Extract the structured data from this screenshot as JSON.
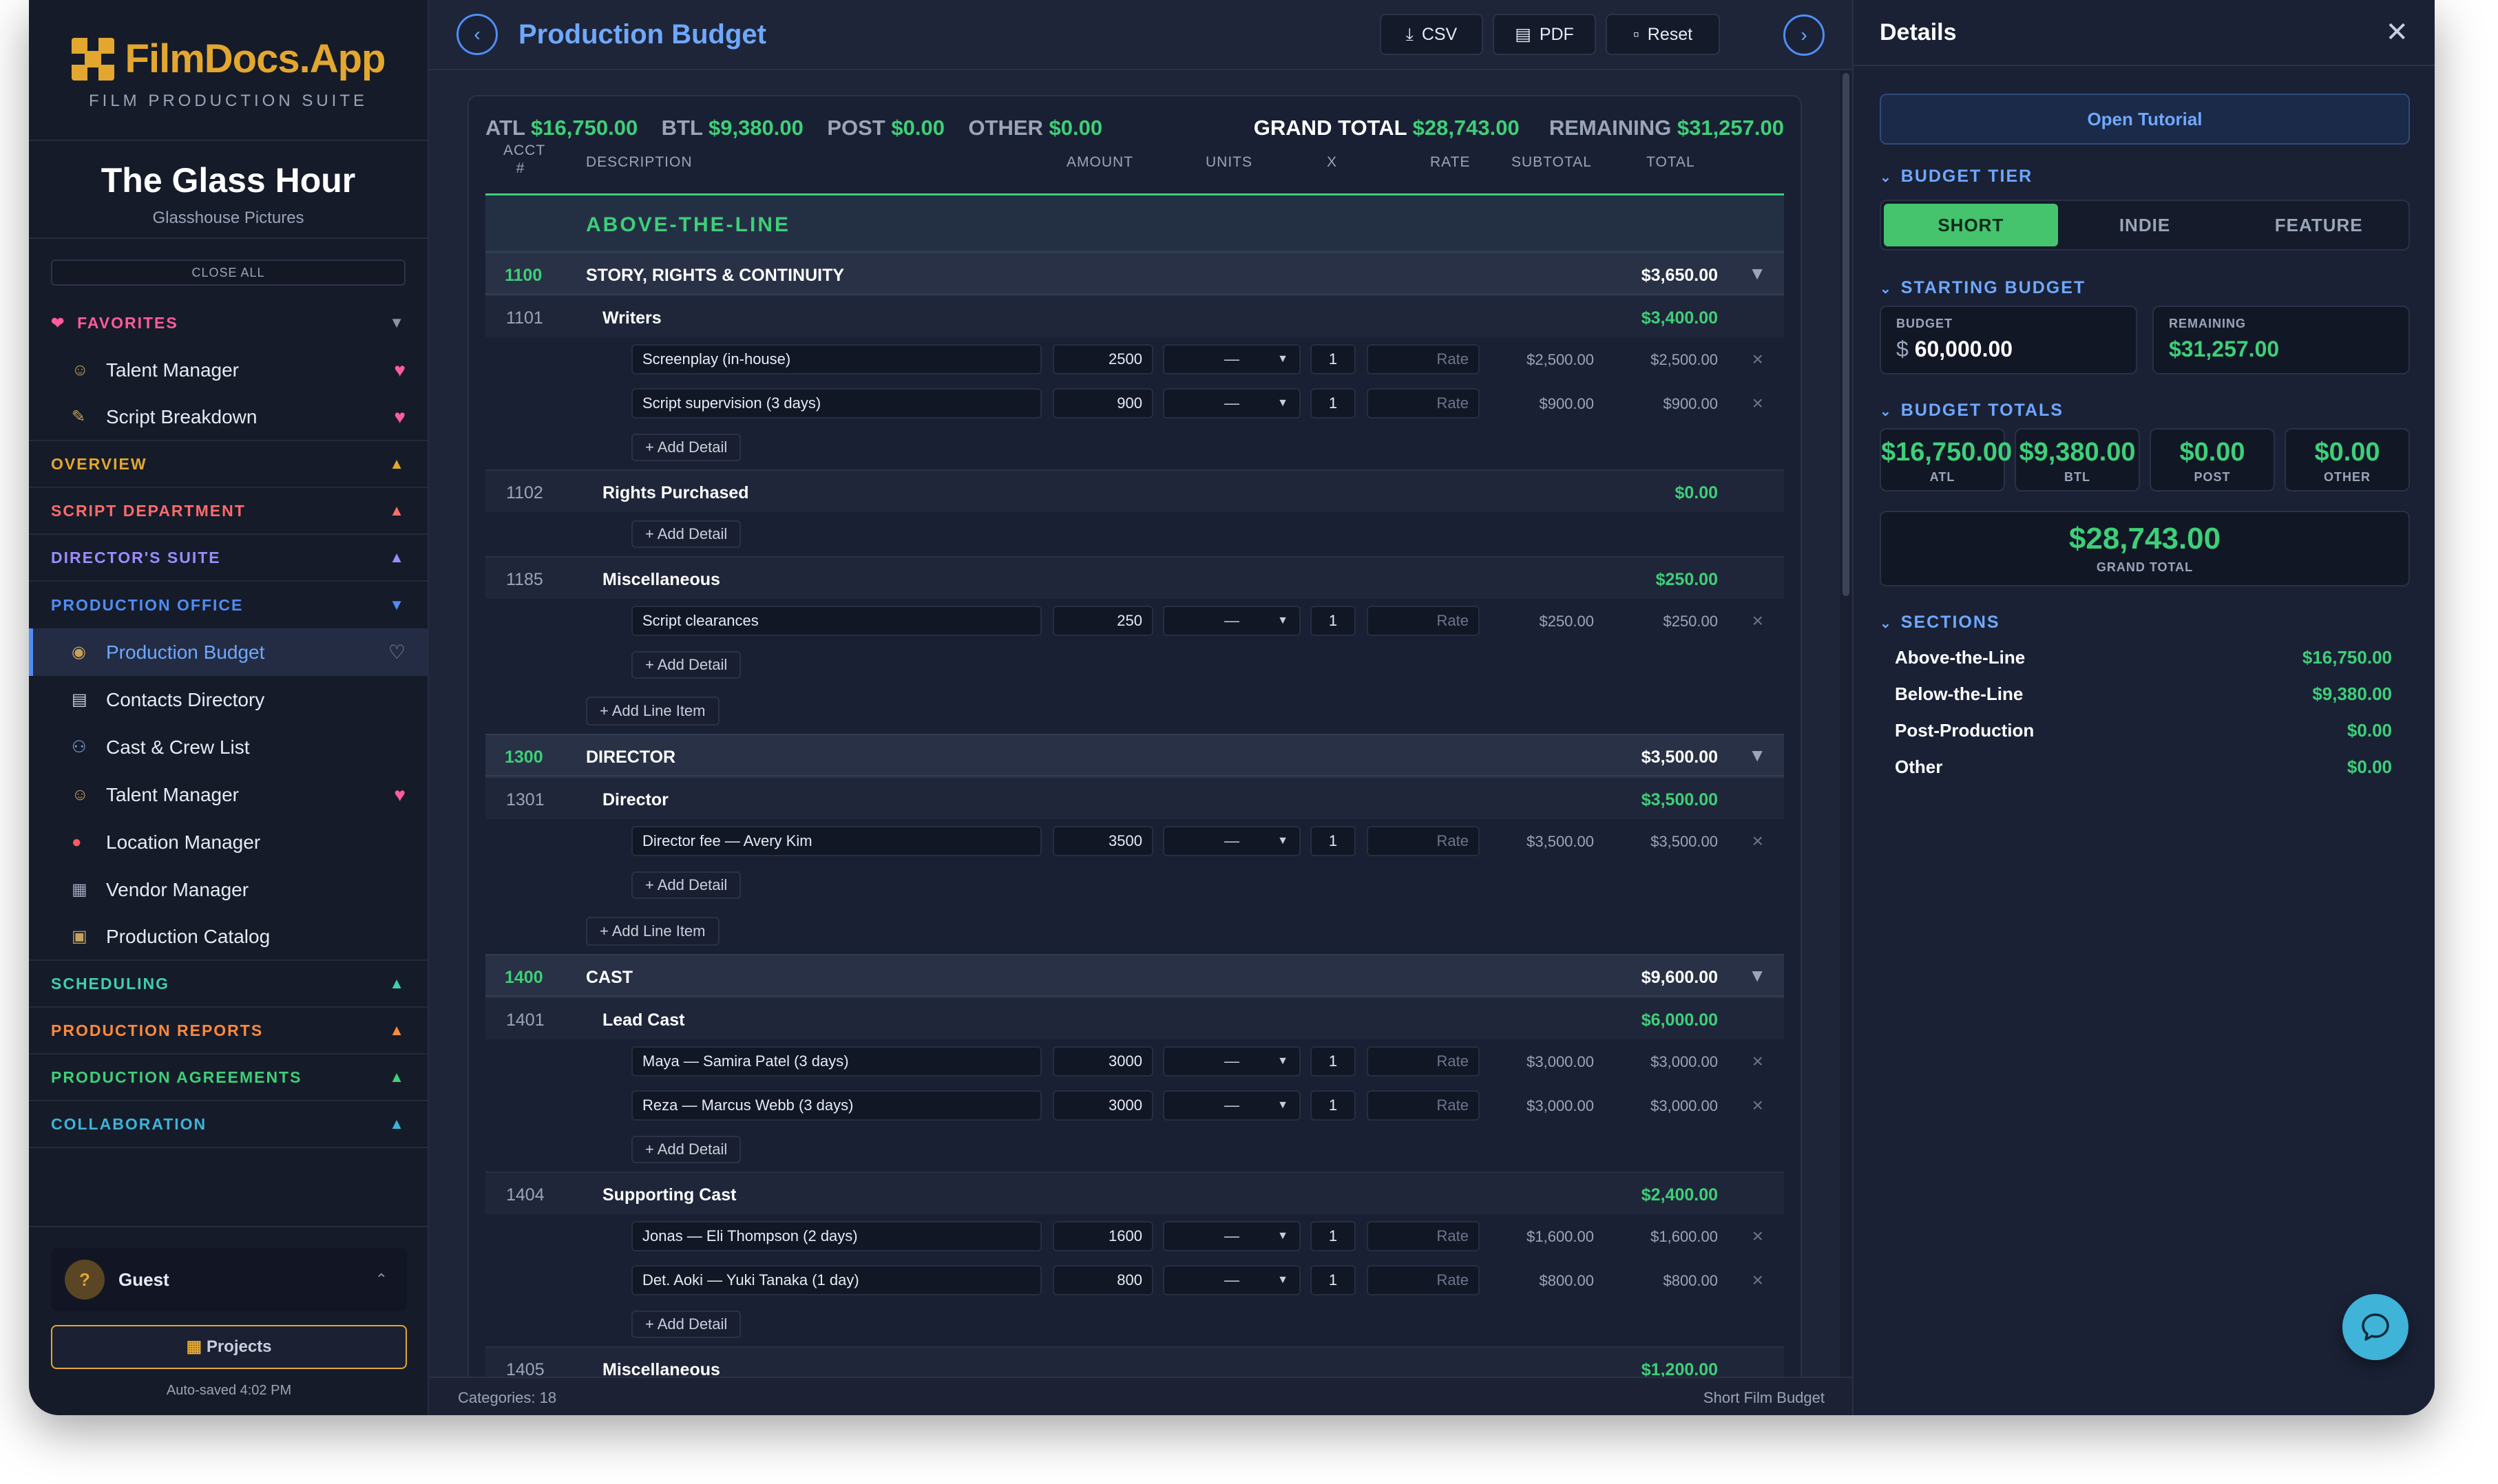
{
  "app": {
    "name": "FilmDocs.App",
    "subtitle": "FILM PRODUCTION SUITE"
  },
  "project": {
    "title": "The Glass Hour",
    "company": "Glasshouse Pictures"
  },
  "sidebar": {
    "close_all": "CLOSE ALL",
    "favorites": {
      "label": "FAVORITES",
      "color": "#ff5c9a",
      "items": [
        {
          "label": "Talent Manager",
          "icon": "theater-masks-icon"
        },
        {
          "label": "Script Breakdown",
          "icon": "memo-icon"
        }
      ]
    },
    "sections": [
      {
        "label": "OVERVIEW",
        "color": "#e3a730"
      },
      {
        "label": "SCRIPT DEPARTMENT",
        "color": "#ff6b6b"
      },
      {
        "label": "DIRECTOR'S SUITE",
        "color": "#9b8cff"
      },
      {
        "label": "PRODUCTION OFFICE",
        "color": "#4f8df5"
      }
    ],
    "office_items": [
      {
        "label": "Production Budget",
        "icon": "money-bag-icon"
      },
      {
        "label": "Contacts Directory",
        "icon": "address-book-icon"
      },
      {
        "label": "Cast & Crew List",
        "icon": "people-icon"
      },
      {
        "label": "Talent Manager",
        "icon": "theater-masks-icon"
      },
      {
        "label": "Location Manager",
        "icon": "pin-icon"
      },
      {
        "label": "Vendor Manager",
        "icon": "building-icon"
      },
      {
        "label": "Production Catalog",
        "icon": "package-icon"
      }
    ],
    "bottom_sections": [
      {
        "label": "SCHEDULING",
        "color": "#3ecfb0"
      },
      {
        "label": "PRODUCTION REPORTS",
        "color": "#ff8a3d"
      },
      {
        "label": "PRODUCTION AGREEMENTS",
        "color": "#3ecf78"
      },
      {
        "label": "COLLABORATION",
        "color": "#3fb3d8"
      }
    ],
    "user": {
      "avatar": "?",
      "name": "Guest"
    },
    "projects_button": "Projects",
    "autosave": "Auto-saved 4:02 PM"
  },
  "toolbar": {
    "title": "Production Budget",
    "csv": "CSV",
    "pdf": "PDF",
    "reset": "Reset"
  },
  "summary": {
    "atl_label": "ATL",
    "atl": "$16,750.00",
    "btl_label": "BTL",
    "btl": "$9,380.00",
    "post_label": "POST",
    "post": "$0.00",
    "other_label": "OTHER",
    "other": "$0.00",
    "grand_label": "GRAND TOTAL",
    "grand": "$28,743.00",
    "remaining_label": "REMAINING",
    "remaining": "$31,257.00"
  },
  "columns": {
    "acct": "ACCT #",
    "description": "DESCRIPTION",
    "amount": "AMOUNT",
    "units": "UNITS",
    "x": "X",
    "rate": "RATE",
    "subtotal": "SUBTOTAL",
    "total": "TOTAL"
  },
  "section_title": "ABOVE-THE-LINE",
  "labels": {
    "add_detail": "+ Add Detail",
    "add_line": "+ Add Line Item",
    "rate_placeholder": "Rate",
    "units_value": "—"
  },
  "categories": [
    {
      "acct": "1100",
      "name": "STORY, RIGHTS & CONTINUITY",
      "total": "$3,650.00",
      "subs": [
        {
          "num": "1101",
          "name": "Writers",
          "total": "$3,400.00",
          "details": [
            {
              "desc": "Screenplay (in-house)",
              "amount": "2500",
              "x": "1",
              "subtotal": "$2,500.00",
              "total": "$2,500.00"
            },
            {
              "desc": "Script supervision (3 days)",
              "amount": "900",
              "x": "1",
              "subtotal": "$900.00",
              "total": "$900.00"
            }
          ]
        },
        {
          "num": "1102",
          "name": "Rights Purchased",
          "total": "$0.00",
          "details": []
        },
        {
          "num": "1185",
          "name": "Miscellaneous",
          "total": "$250.00",
          "details": [
            {
              "desc": "Script clearances",
              "amount": "250",
              "x": "1",
              "subtotal": "$250.00",
              "total": "$250.00"
            }
          ]
        }
      ]
    },
    {
      "acct": "1300",
      "name": "DIRECTOR",
      "total": "$3,500.00",
      "subs": [
        {
          "num": "1301",
          "name": "Director",
          "total": "$3,500.00",
          "details": [
            {
              "desc": "Director fee — Avery Kim",
              "amount": "3500",
              "x": "1",
              "subtotal": "$3,500.00",
              "total": "$3,500.00"
            }
          ]
        }
      ]
    },
    {
      "acct": "1400",
      "name": "CAST",
      "total": "$9,600.00",
      "subs": [
        {
          "num": "1401",
          "name": "Lead Cast",
          "total": "$6,000.00",
          "details": [
            {
              "desc": "Maya — Samira Patel (3 days)",
              "amount": "3000",
              "x": "1",
              "subtotal": "$3,000.00",
              "total": "$3,000.00"
            },
            {
              "desc": "Reza — Marcus Webb (3 days)",
              "amount": "3000",
              "x": "1",
              "subtotal": "$3,000.00",
              "total": "$3,000.00"
            }
          ]
        },
        {
          "num": "1404",
          "name": "Supporting Cast",
          "total": "$2,400.00",
          "details": [
            {
              "desc": "Jonas — Eli Thompson (2 days)",
              "amount": "1600",
              "x": "1",
              "subtotal": "$1,600.00",
              "total": "$1,600.00"
            },
            {
              "desc": "Det. Aoki — Yuki Tanaka (1 day)",
              "amount": "800",
              "x": "1",
              "subtotal": "$800.00",
              "total": "$800.00"
            }
          ]
        },
        {
          "num": "1405",
          "name": "Miscellaneous",
          "total": "$1,200.00",
          "details": []
        }
      ]
    }
  ],
  "status": {
    "left": "Categories: 18",
    "right": "Short Film Budget"
  },
  "details": {
    "title": "Details",
    "tutorial": "Open Tutorial",
    "tier_label": "BUDGET TIER",
    "tiers": [
      "SHORT",
      "INDIE",
      "FEATURE"
    ],
    "starting_label": "STARTING BUDGET",
    "budget_label": "BUDGET",
    "budget_currency": "$",
    "budget_value": "60,000.00",
    "remaining_label": "REMAINING",
    "remaining_value": "$31,257.00",
    "totals_label": "BUDGET TOTALS",
    "totals": [
      {
        "value": "$16,750.00",
        "label": "ATL"
      },
      {
        "value": "$9,380.00",
        "label": "BTL"
      },
      {
        "value": "$0.00",
        "label": "POST"
      },
      {
        "value": "$0.00",
        "label": "OTHER"
      }
    ],
    "grand_value": "$28,743.00",
    "grand_label": "GRAND TOTAL",
    "sections_label": "SECTIONS",
    "sections": [
      {
        "name": "Above-the-Line",
        "amount": "$16,750.00"
      },
      {
        "name": "Below-the-Line",
        "amount": "$9,380.00"
      },
      {
        "name": "Post-Production",
        "amount": "$0.00"
      },
      {
        "name": "Other",
        "amount": "$0.00"
      }
    ]
  }
}
